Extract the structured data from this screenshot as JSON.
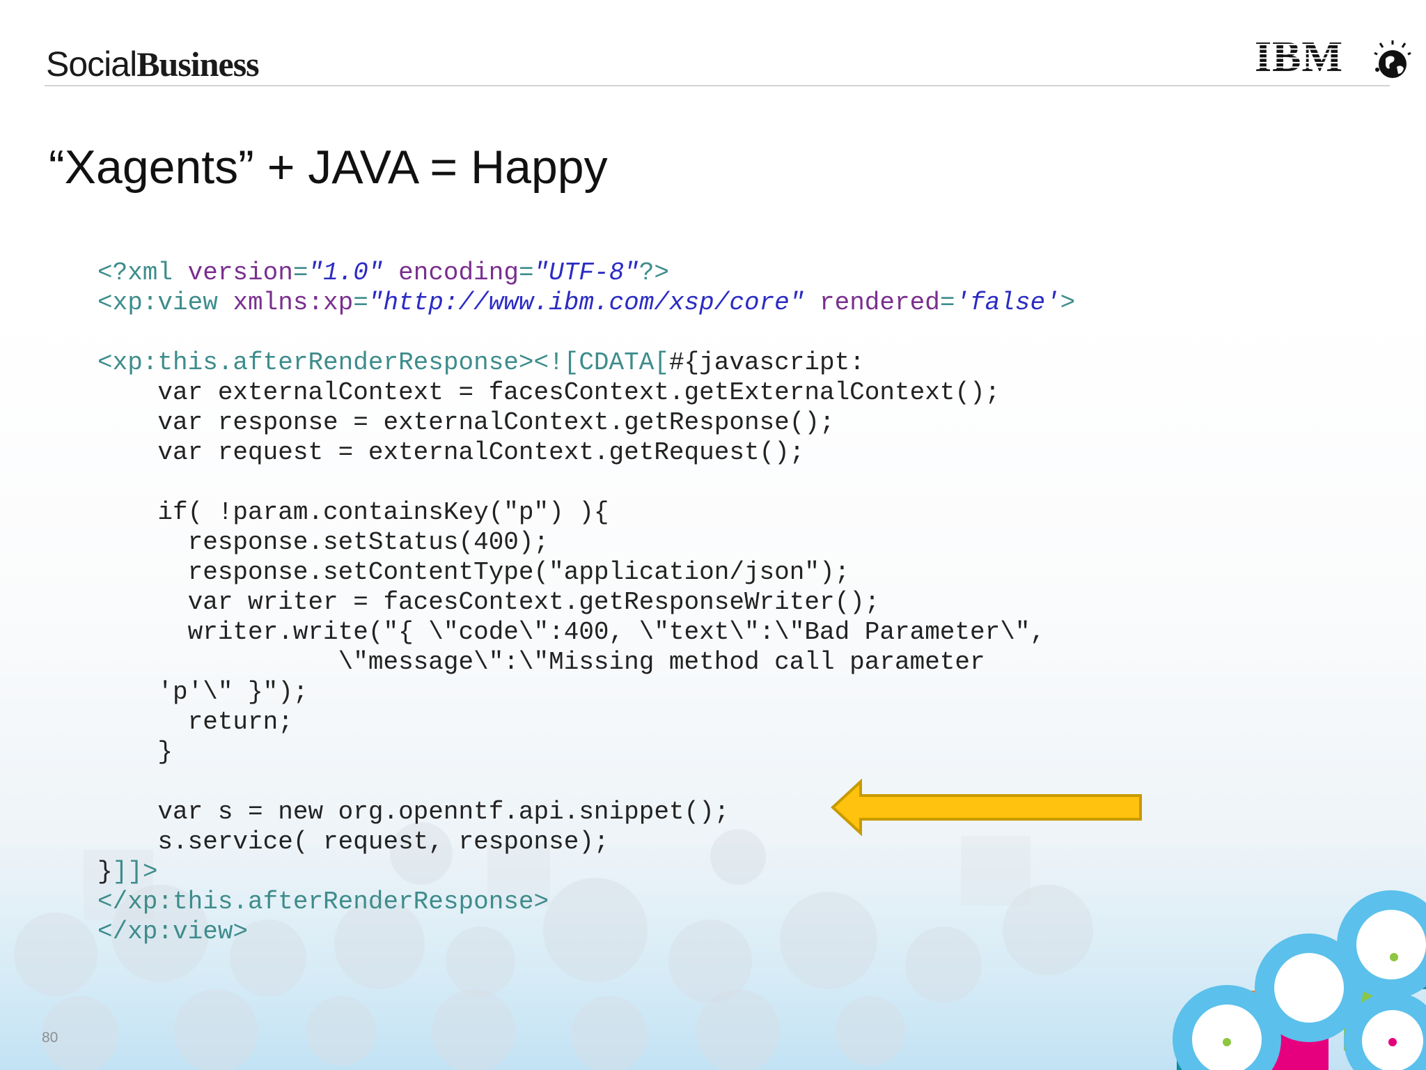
{
  "header": {
    "brand_light": "Social",
    "brand_bold": "Business",
    "logo_text": "IBM",
    "logo_icon": "ibm-smarter-planet-globe-icon"
  },
  "slide": {
    "title": "“Xagents” + JAVA = Happy",
    "page_number": "80"
  },
  "code": {
    "lines": [
      [
        {
          "t": "<?xml ",
          "c": "tag"
        },
        {
          "t": "version",
          "c": "attr"
        },
        {
          "t": "=",
          "c": "tag"
        },
        {
          "t": "\"1.0\"",
          "c": "val"
        },
        {
          "t": " ",
          "c": "plain"
        },
        {
          "t": "encoding",
          "c": "attr"
        },
        {
          "t": "=",
          "c": "tag"
        },
        {
          "t": "\"UTF-8\"",
          "c": "val"
        },
        {
          "t": "?>",
          "c": "tag"
        }
      ],
      [
        {
          "t": "<xp:view ",
          "c": "tag"
        },
        {
          "t": "xmlns:xp",
          "c": "attr"
        },
        {
          "t": "=",
          "c": "tag"
        },
        {
          "t": "\"http://www.ibm.com/xsp/core\"",
          "c": "val"
        },
        {
          "t": " ",
          "c": "plain"
        },
        {
          "t": "rendered",
          "c": "attr"
        },
        {
          "t": "=",
          "c": "tag"
        },
        {
          "t": "'false'",
          "c": "val"
        },
        {
          "t": ">",
          "c": "tag"
        }
      ],
      [],
      [
        {
          "t": "<xp:this.afterRenderResponse><![CDATA[",
          "c": "tag"
        },
        {
          "t": "#{javascript:",
          "c": "plain"
        }
      ],
      [
        {
          "t": "    var externalContext = facesContext.getExternalContext();",
          "c": "plain"
        }
      ],
      [
        {
          "t": "    var response = externalContext.getResponse();",
          "c": "plain"
        }
      ],
      [
        {
          "t": "    var request = externalContext.getRequest();",
          "c": "plain"
        }
      ],
      [],
      [
        {
          "t": "    if( !param.containsKey(\"p\") ){",
          "c": "plain"
        }
      ],
      [
        {
          "t": "      response.setStatus(400);",
          "c": "plain"
        }
      ],
      [
        {
          "t": "      response.setContentType(\"application/json\");",
          "c": "plain"
        }
      ],
      [
        {
          "t": "      var writer = facesContext.getResponseWriter();",
          "c": "plain"
        }
      ],
      [
        {
          "t": "      writer.write(\"{ \\\"code\\\":400, \\\"text\\\":\\\"Bad Parameter\\\",",
          "c": "plain"
        }
      ],
      [
        {
          "t": "                \\\"message\\\":\\\"Missing method call parameter",
          "c": "plain"
        }
      ],
      [
        {
          "t": "    'p'\\\" }\");",
          "c": "plain"
        }
      ],
      [
        {
          "t": "      return;",
          "c": "plain"
        }
      ],
      [
        {
          "t": "    }",
          "c": "plain"
        }
      ],
      [],
      [
        {
          "t": "    var s = new org.openntf.api.snippet();",
          "c": "plain"
        }
      ],
      [
        {
          "t": "    s.service( request, response);",
          "c": "plain"
        }
      ],
      [
        {
          "t": "}",
          "c": "plain"
        },
        {
          "t": "]]>",
          "c": "tag"
        }
      ],
      [
        {
          "t": "</xp:this.afterRenderResponse>",
          "c": "tag"
        }
      ],
      [
        {
          "t": "</xp:view>",
          "c": "tag"
        }
      ]
    ]
  },
  "annotation": {
    "arrow_icon": "left-arrow-icon",
    "arrow_color": "#FFC20E",
    "arrow_border": "#C79A00"
  },
  "colors": {
    "xml_tag": "#3E8C8C",
    "xml_attr": "#7A2F8E",
    "xml_value": "#2B2BC4",
    "code_text": "#222222",
    "deco_blue": "#5BC0EB",
    "deco_orange": "#F58220",
    "deco_pink": "#E6007E",
    "deco_green": "#8DC63F",
    "deco_teal": "#0F8BA6"
  }
}
